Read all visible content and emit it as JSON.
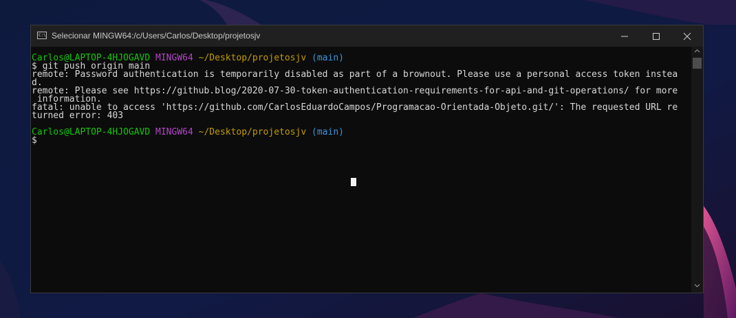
{
  "window": {
    "title": "Selecionar MINGW64:/c/Users/Carlos/Desktop/projetosjv",
    "app_icon_text": "C:\\_"
  },
  "terminal": {
    "prompt1": {
      "user": "Carlos@LAPTOP-4HJOGAVD",
      "shell": "MINGW64",
      "path": "~/Desktop/projetosjv",
      "branch": "(main)"
    },
    "command": "$ git push origin main",
    "output": [
      "remote: Password authentication is temporarily disabled as part of a brownout. Please use a personal access token instea",
      "d.",
      "remote: Please see https://github.blog/2020-07-30-token-authentication-requirements-for-api-and-git-operations/ for more",
      " information.",
      "fatal: unable to access 'https://github.com/CarlosEduardoCampos/Programacao-Orientada-Objeto.git/': The requested URL re",
      "turned error: 403"
    ],
    "prompt2": {
      "user": "Carlos@LAPTOP-4HJOGAVD",
      "shell": "MINGW64",
      "path": "~/Desktop/projetosjv",
      "branch": "(main)"
    },
    "input_line": "$"
  },
  "colors": {
    "user": "#16c60c",
    "shell": "#b148c6",
    "path": "#c19c00",
    "branch": "#3a96dd",
    "background": "#0c0c0c"
  },
  "icons": {
    "minimize": "minimize-icon",
    "maximize": "maximize-icon",
    "close": "close-icon",
    "scroll_up": "chevron-up-icon",
    "scroll_down": "chevron-down-icon"
  }
}
